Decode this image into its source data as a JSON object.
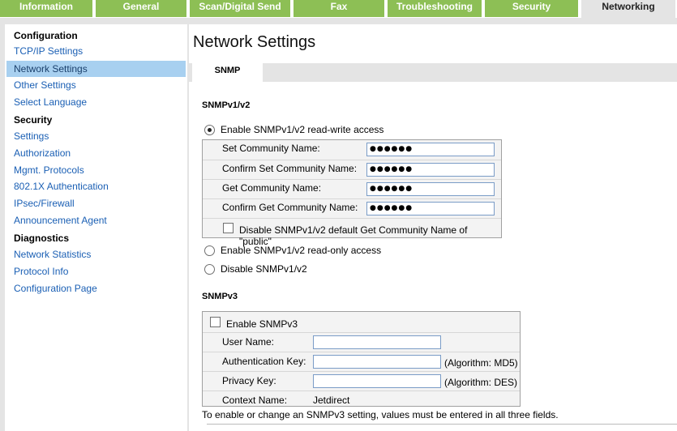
{
  "top_tabs": [
    {
      "label": "Information",
      "active": false
    },
    {
      "label": "General",
      "active": false
    },
    {
      "label": "Scan/Digital Send",
      "active": false
    },
    {
      "label": "Fax",
      "active": false
    },
    {
      "label": "Troubleshooting",
      "active": false
    },
    {
      "label": "Security",
      "active": false
    },
    {
      "label": "Networking",
      "active": true
    }
  ],
  "sidebar": {
    "configuration_head": "Configuration",
    "tcpip": "TCP/IP Settings",
    "network_settings": "Network Settings",
    "other_settings": "Other Settings",
    "select_language": "Select Language",
    "security_head": "Security",
    "settings": "Settings",
    "authorization": "Authorization",
    "mgmt_protocols": "Mgmt. Protocols",
    "auth_8021x": "802.1X Authentication",
    "ipsec": "IPsec/Firewall",
    "announcement": "Announcement Agent",
    "diagnostics_head": "Diagnostics",
    "network_statistics": "Network Statistics",
    "protocol_info": "Protocol Info",
    "configuration_page": "Configuration Page"
  },
  "main": {
    "title": "Network Settings",
    "subtab": "SNMP",
    "v1v2": {
      "heading": "SNMPv1/v2",
      "rw_label": "Enable SNMPv1/v2 read-write access",
      "set_name_label": "Set Community Name:",
      "set_name_value": "●●●●●●",
      "confirm_set_label": "Confirm Set Community Name:",
      "confirm_set_value": "●●●●●●",
      "get_name_label": "Get Community Name:",
      "get_name_value": "●●●●●●",
      "confirm_get_label": "Confirm Get Community Name:",
      "confirm_get_value": "●●●●●●",
      "disable_public_label": "Disable SNMPv1/v2 default Get Community Name of \"public\"",
      "ro_label": "Enable SNMPv1/v2 read-only access",
      "disable_label": "Disable SNMPv1/v2"
    },
    "v3": {
      "heading": "SNMPv3",
      "enable_label": "Enable SNMPv3",
      "user_name_label": "User Name:",
      "auth_key_label": "Authentication Key:",
      "auth_algo": "(Algorithm: MD5)",
      "privacy_key_label": "Privacy Key:",
      "privacy_algo": "(Algorithm: DES)",
      "context_label": "Context Name:",
      "context_value": "Jetdirect"
    },
    "note": "To enable or change an SNMPv3 setting, values must be entered in all three fields."
  }
}
